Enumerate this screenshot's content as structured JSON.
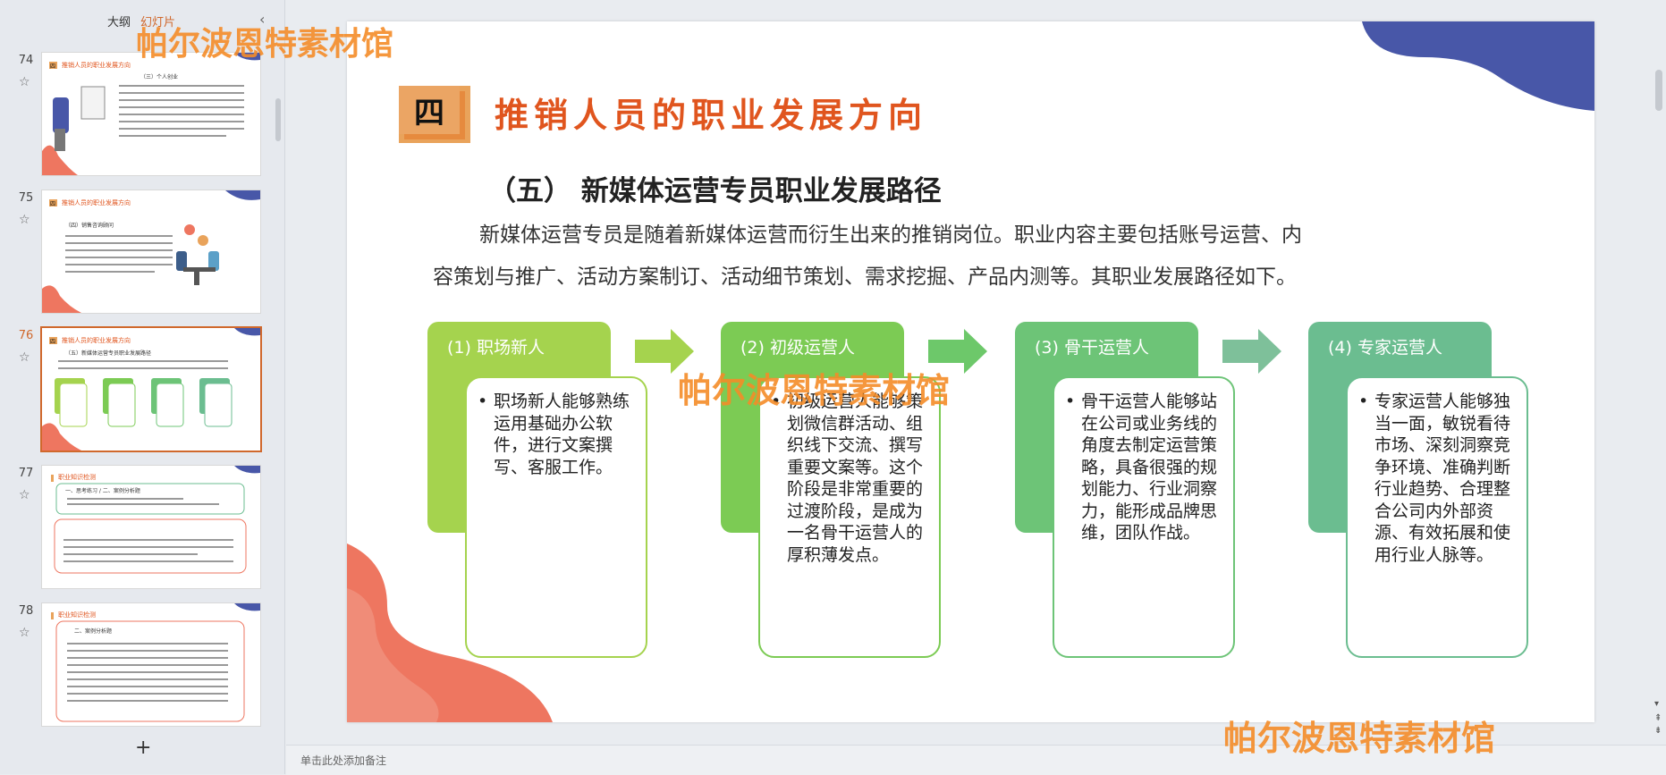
{
  "left_pane": {
    "tab_outline": "大纲",
    "tab_slides": "幻灯片",
    "add_slide_icon": "+",
    "thumbnails": [
      {
        "number": "74",
        "header": "推销人员的职业发展方向",
        "section_num": "四",
        "subheading": "（三）个人创业"
      },
      {
        "number": "75",
        "header": "推销人员的职业发展方向",
        "section_num": "四",
        "subheading": "（四）销售咨询顾问"
      },
      {
        "number": "76",
        "header": "推销人员的职业发展方向",
        "section_num": "四",
        "subheading": "（五）新媒体运营专员职业发展路径"
      },
      {
        "number": "77",
        "header": "职业知识检测",
        "section_num": "",
        "subheading": "一、思考练习 / 二、案例分析题"
      },
      {
        "number": "78",
        "header": "职业知识检测",
        "section_num": "",
        "subheading": "二、案例分析题"
      }
    ]
  },
  "slide": {
    "section_num": "四",
    "section_title": "推销人员的职业发展方向",
    "subtitle": "（五） 新媒体运营专员职业发展路径",
    "intro_line1": "新媒体运营专员是随着新媒体运营而衍生出来的推销岗位。职业内容主要包括账号运营、内",
    "intro_line2": "容策划与推广、活动方案制订、活动细节策划、需求挖掘、产品内测等。其职业发展路径如下。",
    "stages": [
      {
        "label": "(1)   职场新人",
        "text": "职场新人能够熟练运用基础办公软件，进行文案撰写、客服工作。",
        "color": "#a5d34e"
      },
      {
        "label": "(2)   初级运营人",
        "text": "初级运营人能够策划微信群活动、组织线下交流、撰写重要文案等。这个阶段是非常重要的过渡阶段，是成为一名骨干运营人的厚积薄发点。",
        "color": "#7ccb54"
      },
      {
        "label": "(3)   骨干运营人",
        "text": "骨干运营人能够站在公司或业务线的角度去制定运营策略，具备很强的规划能力、行业洞察力，能形成品牌思维，团队作战。",
        "color": "#6dc477"
      },
      {
        "label": "(4)   专家运营人",
        "text": "专家运营人能够独当一面，敏锐看待市场、深刻洞察竞争环境、准确判断行业趋势、合理整合公司内外部资源、有效拓展和使用行业人脉等。",
        "color": "#6bbd90"
      }
    ],
    "bullet": "•"
  },
  "notes_placeholder": "单击此处添加备注",
  "watermark": "帕尔波恩特素材馆",
  "colors": {
    "accent": "#d0682c",
    "title_orange": "#e0551e",
    "blob_blue": "#4857a8",
    "blob_coral": "#ee7660"
  }
}
